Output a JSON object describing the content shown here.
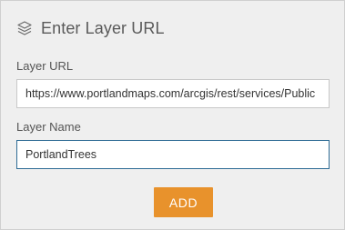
{
  "header": {
    "icon": "layers-icon",
    "title": "Enter Layer URL"
  },
  "form": {
    "url_label": "Layer URL",
    "url_value": "https://www.portlandmaps.com/arcgis/rest/services/Public",
    "name_label": "Layer Name",
    "name_value": "PortlandTrees",
    "add_label": "ADD"
  },
  "colors": {
    "accent": "#e8922c",
    "focus_border": "#2f6c95",
    "panel_background": "#efefef"
  }
}
